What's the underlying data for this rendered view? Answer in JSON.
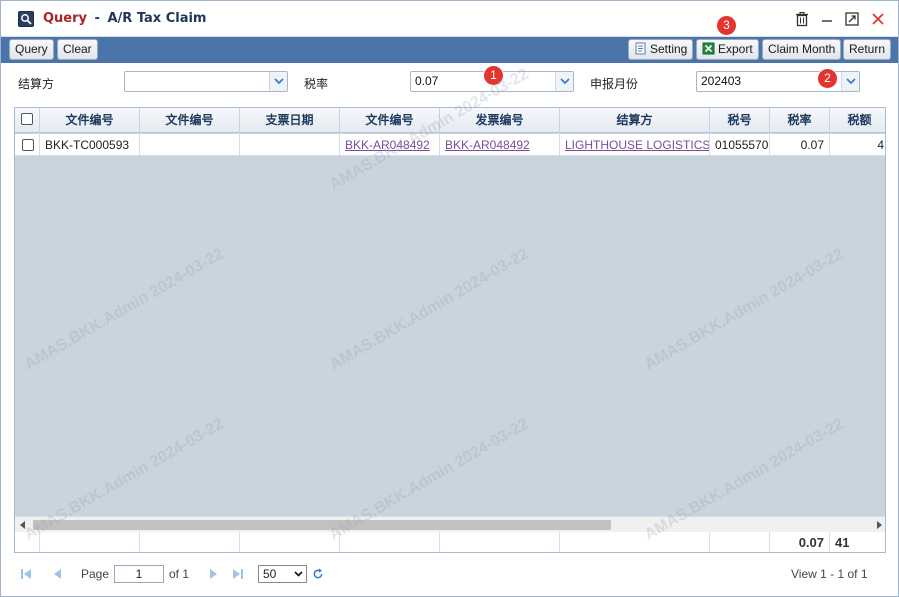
{
  "window": {
    "title_action": "Query",
    "title_separator": "-",
    "title_name": "A/R Tax Claim",
    "icons": [
      "search-icon",
      "trash-icon",
      "minimize-icon",
      "maximize-icon",
      "close-icon"
    ]
  },
  "toolbar": {
    "query_label": "Query",
    "clear_label": "Clear",
    "setting_label": "Setting",
    "export_label": "Export",
    "claim_month_label": "Claim Month",
    "return_label": "Return"
  },
  "filters": {
    "settlement_label": "结算方",
    "settlement_value": "",
    "tax_rate_label": "税率",
    "tax_rate_value": "0.07",
    "declare_month_label": "申报月份",
    "declare_month_value": "202403"
  },
  "badges": [
    "1",
    "2",
    "3"
  ],
  "grid": {
    "columns": [
      "文件编号",
      "文件编号",
      "支票日期",
      "文件编号",
      "发票编号",
      "结算方",
      "税号",
      "税率",
      "税额"
    ],
    "rows": [
      {
        "doc_no": "BKK-TC000593",
        "doc_no_2": "",
        "cheque_date": "",
        "doc_no_3": "BKK-AR048492",
        "invoice_no": "BKK-AR048492",
        "settlement": "LIGHTHOUSE LOGISTICS",
        "tax_id": "01055570",
        "tax_rate": "0.07",
        "tax_amount": "4"
      }
    ],
    "footer": {
      "tax_rate_total": "0.07",
      "tax_amount_total": "41"
    }
  },
  "pager": {
    "page_label": "Page",
    "page_value": "1",
    "of_label": "of 1",
    "page_size": "50",
    "view_info": "View 1 - 1 of 1"
  },
  "watermark_text": "AMAS.BKK.Admin 2024-03-22",
  "colors": {
    "toolbar_bg": "#4a74aa",
    "title_action": "#a8232a",
    "title_name": "#1f3658",
    "badge": "#e3342f",
    "link": "#7a4c9e",
    "grid_bg": "#cad4df"
  }
}
